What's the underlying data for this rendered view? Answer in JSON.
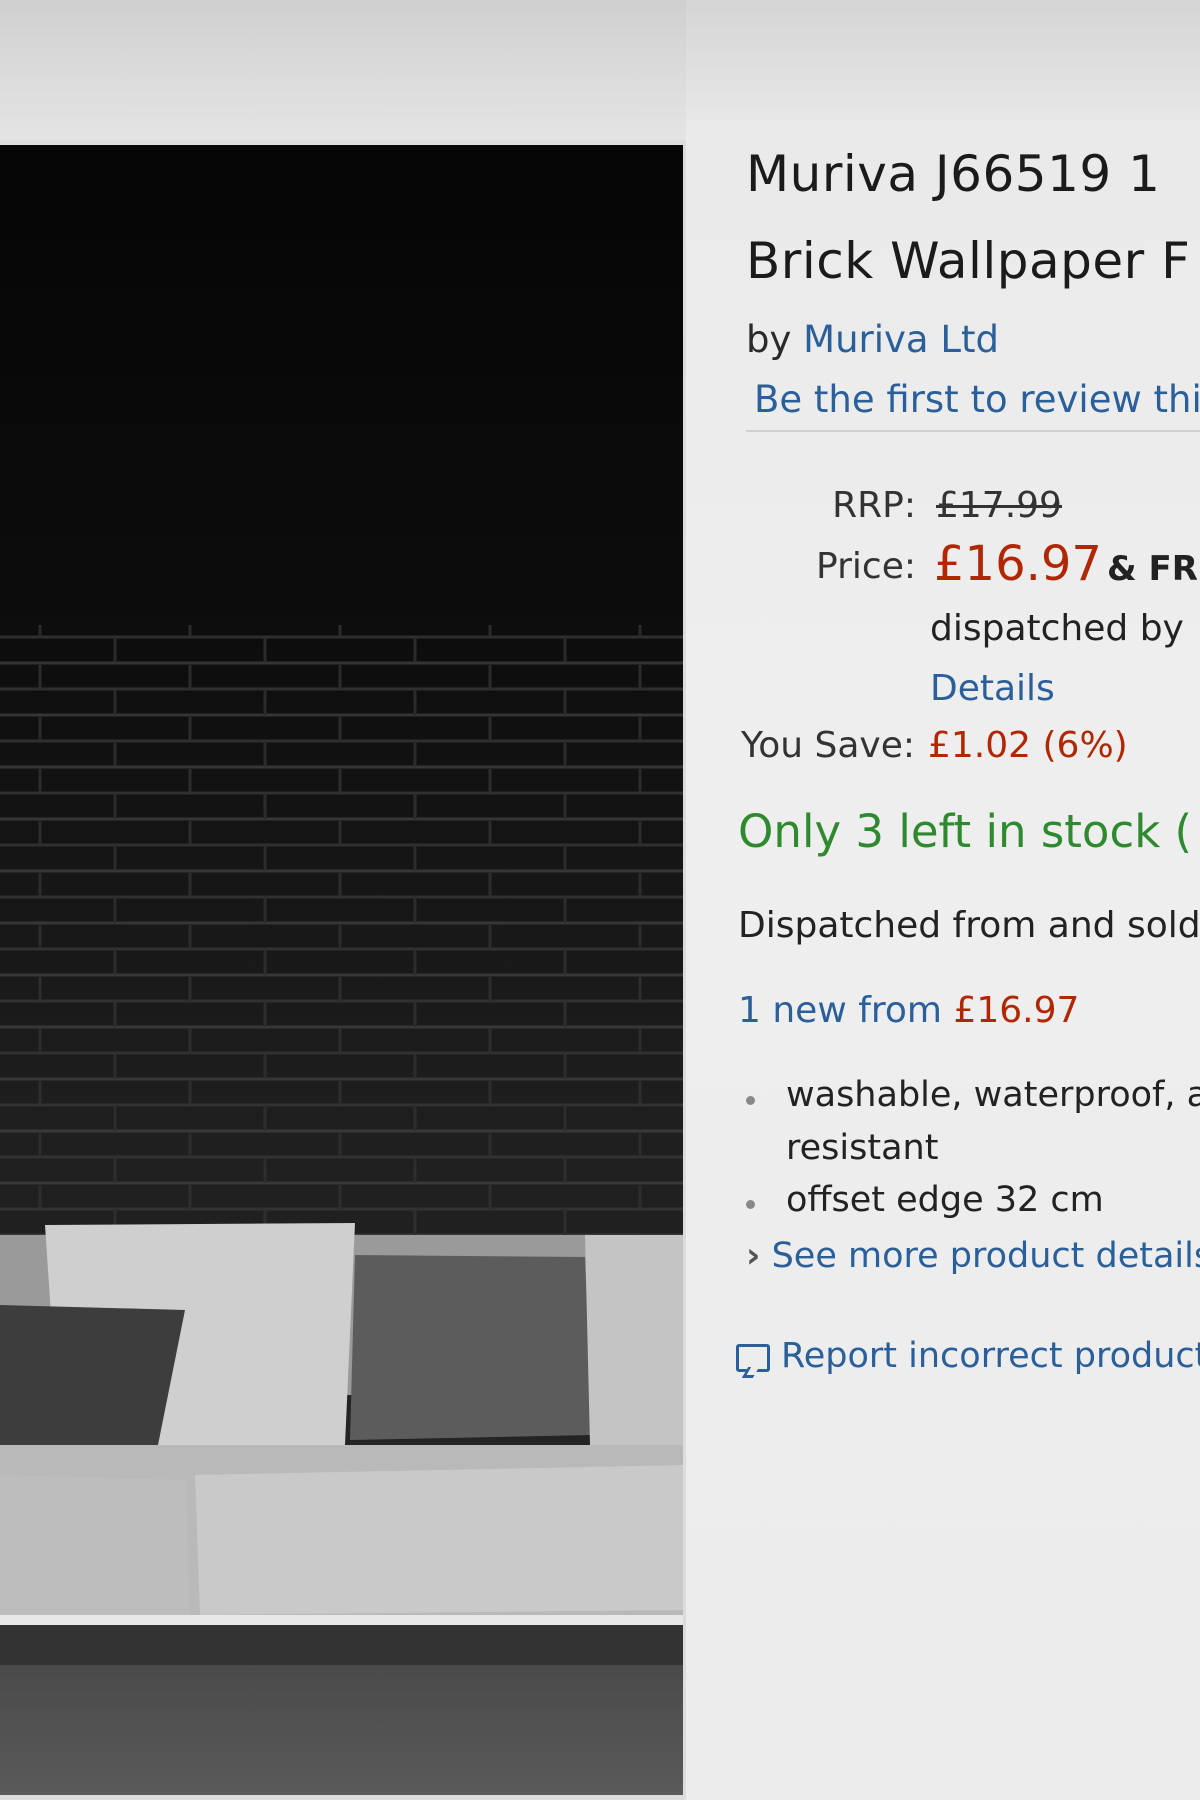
{
  "product": {
    "title_line1": "Muriva J66519 1",
    "title_line2": "Brick Wallpaper F",
    "by_prefix": "by",
    "brand": "Muriva Ltd",
    "review_prompt": "Be the first to review thi"
  },
  "pricing": {
    "rrp_label": "RRP:",
    "rrp_value": "£17.99",
    "price_label": "Price:",
    "price_value": "£16.97",
    "price_suffix": "& FR",
    "dispatched_by": "dispatched by",
    "details_link": "Details",
    "save_label": "You Save:",
    "save_value": "£1.02 (6%)"
  },
  "availability": {
    "stock": "Only 3 left in stock (",
    "sold_by": "Dispatched from and sold",
    "offers_prefix": "1 new from",
    "offers_price": "£16.97"
  },
  "features": {
    "bullets": [
      {
        "line1": "washable, waterproof, a",
        "line2": "resistant"
      },
      {
        "line1": "offset edge 32 cm"
      }
    ],
    "see_more": "See more product details",
    "see_more_chevron": "›"
  },
  "report": {
    "label": "Report incorrect product",
    "icon": "speech-bubble-icon"
  },
  "colors": {
    "price": "#b12704",
    "link": "#2a5f9a",
    "stock": "#2f8a2f"
  }
}
